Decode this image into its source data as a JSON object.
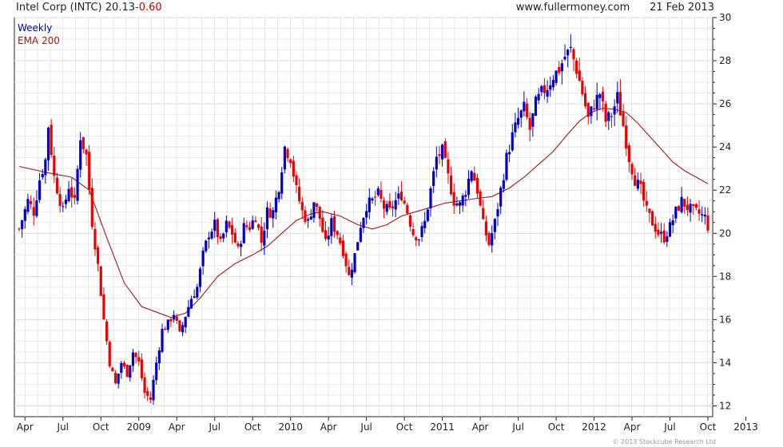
{
  "header": {
    "title": "Intel Corp (INTC)",
    "last": "20.13",
    "change": "-0.60",
    "site": "www.fullermoney.com",
    "date": "21 Feb 2013"
  },
  "legend": {
    "weekly": "Weekly",
    "ema": "EMA 200"
  },
  "copyright": "© 2013 Stockcube Research Ltd",
  "colors": {
    "up": "#0000cc",
    "down": "#ee0000",
    "ema": "#a01818",
    "grid": "#dcdcdc",
    "weekly_label": "#0000aa",
    "ema_label": "#a01818"
  },
  "chart_data": {
    "type": "candlestick",
    "title": "Intel Corp (INTC) 20.13 -0.60",
    "ylim": [
      11.5,
      30
    ],
    "y_ticks": [
      12,
      14,
      16,
      18,
      20,
      22,
      24,
      26,
      28,
      30
    ],
    "x_ticks": [
      "Apr",
      "Jul",
      "Oct",
      "2009",
      "Apr",
      "Jul",
      "Oct",
      "2010",
      "Apr",
      "Jul",
      "Oct",
      "2011",
      "Apr",
      "Jul",
      "Oct",
      "2012",
      "Apr",
      "Jul",
      "Oct",
      "2013"
    ],
    "x_tick_weeks": [
      2,
      15,
      28,
      41,
      54,
      67,
      80,
      93,
      106,
      119,
      132,
      145,
      158,
      171,
      184,
      197,
      210,
      223,
      236,
      249
    ],
    "grid": true,
    "series": [
      {
        "name": "Weekly",
        "kind": "ohlc_weekly",
        "close_anchors": [
          [
            0,
            20.2
          ],
          [
            3,
            21.5
          ],
          [
            5,
            21.0
          ],
          [
            7,
            22.5
          ],
          [
            9,
            23.4
          ],
          [
            10,
            25.0
          ],
          [
            12,
            22.6
          ],
          [
            15,
            21.0
          ],
          [
            17,
            22.2
          ],
          [
            19,
            21.4
          ],
          [
            21,
            24.5
          ],
          [
            23,
            23.6
          ],
          [
            25,
            20.5
          ],
          [
            27,
            18.5
          ],
          [
            29,
            16.0
          ],
          [
            31,
            14.0
          ],
          [
            33,
            13.0
          ],
          [
            35,
            14.0
          ],
          [
            37,
            13.5
          ],
          [
            39,
            14.5
          ],
          [
            41,
            14.0
          ],
          [
            43,
            12.6
          ],
          [
            45,
            12.3
          ],
          [
            47,
            14.0
          ],
          [
            49,
            15.5
          ],
          [
            51,
            15.8
          ],
          [
            53,
            16.3
          ],
          [
            55,
            15.3
          ],
          [
            57,
            16.2
          ],
          [
            59,
            17.0
          ],
          [
            61,
            17.5
          ],
          [
            63,
            19.0
          ],
          [
            65,
            20.0
          ],
          [
            67,
            20.4
          ],
          [
            69,
            19.5
          ],
          [
            71,
            20.4
          ],
          [
            73,
            20.0
          ],
          [
            75,
            19.2
          ],
          [
            77,
            20.3
          ],
          [
            79,
            20.3
          ],
          [
            81,
            20.8
          ],
          [
            83,
            19.6
          ],
          [
            85,
            21.0
          ],
          [
            87,
            21.0
          ],
          [
            89,
            22.2
          ],
          [
            91,
            24.0
          ],
          [
            93,
            23.5
          ],
          [
            95,
            22.0
          ],
          [
            97,
            21.0
          ],
          [
            99,
            20.5
          ],
          [
            101,
            21.5
          ],
          [
            103,
            20.7
          ],
          [
            105,
            19.5
          ],
          [
            107,
            20.5
          ],
          [
            109,
            20.0
          ],
          [
            111,
            19.2
          ],
          [
            113,
            18.0
          ],
          [
            115,
            19.0
          ],
          [
            117,
            20.4
          ],
          [
            119,
            21.3
          ],
          [
            121,
            21.5
          ],
          [
            123,
            21.8
          ],
          [
            125,
            21.2
          ],
          [
            127,
            21.0
          ],
          [
            129,
            21.5
          ],
          [
            131,
            21.8
          ],
          [
            133,
            21.0
          ],
          [
            135,
            20.0
          ],
          [
            137,
            19.8
          ],
          [
            139,
            20.5
          ],
          [
            141,
            22.0
          ],
          [
            143,
            23.5
          ],
          [
            145,
            23.8
          ],
          [
            147,
            22.6
          ],
          [
            149,
            21.5
          ],
          [
            151,
            21.3
          ],
          [
            153,
            22.0
          ],
          [
            155,
            23.0
          ],
          [
            157,
            22.0
          ],
          [
            159,
            20.4
          ],
          [
            161,
            19.5
          ],
          [
            163,
            20.5
          ],
          [
            165,
            22.0
          ],
          [
            167,
            23.5
          ],
          [
            169,
            24.5
          ],
          [
            171,
            25.3
          ],
          [
            173,
            25.8
          ],
          [
            175,
            24.8
          ],
          [
            177,
            26.0
          ],
          [
            179,
            26.5
          ],
          [
            181,
            26.8
          ],
          [
            183,
            27.3
          ],
          [
            185,
            27.6
          ],
          [
            187,
            28.2
          ],
          [
            189,
            28.5
          ],
          [
            191,
            27.6
          ],
          [
            193,
            26.5
          ],
          [
            195,
            25.3
          ],
          [
            197,
            26.0
          ],
          [
            199,
            26.5
          ],
          [
            201,
            25.2
          ],
          [
            203,
            25.5
          ],
          [
            205,
            26.3
          ],
          [
            207,
            25.0
          ],
          [
            209,
            23.5
          ],
          [
            211,
            22.5
          ],
          [
            213,
            22.0
          ],
          [
            215,
            21.0
          ],
          [
            217,
            20.5
          ],
          [
            219,
            20.0
          ],
          [
            221,
            19.8
          ],
          [
            223,
            20.3
          ],
          [
            225,
            21.0
          ],
          [
            227,
            21.5
          ],
          [
            229,
            21.2
          ],
          [
            231,
            21.0
          ],
          [
            233,
            20.9
          ],
          [
            235,
            20.73
          ],
          [
            236,
            20.13
          ]
        ],
        "weeks": 237,
        "swing_pct": 0.045
      },
      {
        "name": "EMA 200",
        "kind": "line",
        "points": [
          [
            0,
            23.1
          ],
          [
            10,
            22.8
          ],
          [
            18,
            22.6
          ],
          [
            24,
            22.0
          ],
          [
            30,
            19.8
          ],
          [
            36,
            17.7
          ],
          [
            42,
            16.6
          ],
          [
            48,
            16.3
          ],
          [
            52,
            16.1
          ],
          [
            57,
            16.3
          ],
          [
            62,
            17.0
          ],
          [
            68,
            18.0
          ],
          [
            74,
            18.6
          ],
          [
            80,
            19.0
          ],
          [
            85,
            19.4
          ],
          [
            90,
            20.0
          ],
          [
            95,
            20.6
          ],
          [
            100,
            20.9
          ],
          [
            104,
            21.0
          ],
          [
            110,
            20.8
          ],
          [
            116,
            20.4
          ],
          [
            121,
            20.2
          ],
          [
            126,
            20.4
          ],
          [
            131,
            20.8
          ],
          [
            136,
            21.0
          ],
          [
            141,
            21.2
          ],
          [
            146,
            21.4
          ],
          [
            151,
            21.5
          ],
          [
            156,
            21.6
          ],
          [
            162,
            21.7
          ],
          [
            168,
            22.1
          ],
          [
            173,
            22.6
          ],
          [
            178,
            23.2
          ],
          [
            183,
            23.8
          ],
          [
            188,
            24.6
          ],
          [
            192,
            25.2
          ],
          [
            196,
            25.6
          ],
          [
            200,
            25.8
          ],
          [
            204,
            25.75
          ],
          [
            208,
            25.6
          ],
          [
            212,
            25.1
          ],
          [
            216,
            24.5
          ],
          [
            220,
            23.9
          ],
          [
            224,
            23.3
          ],
          [
            228,
            22.9
          ],
          [
            232,
            22.6
          ],
          [
            236,
            22.3
          ]
        ]
      }
    ]
  }
}
